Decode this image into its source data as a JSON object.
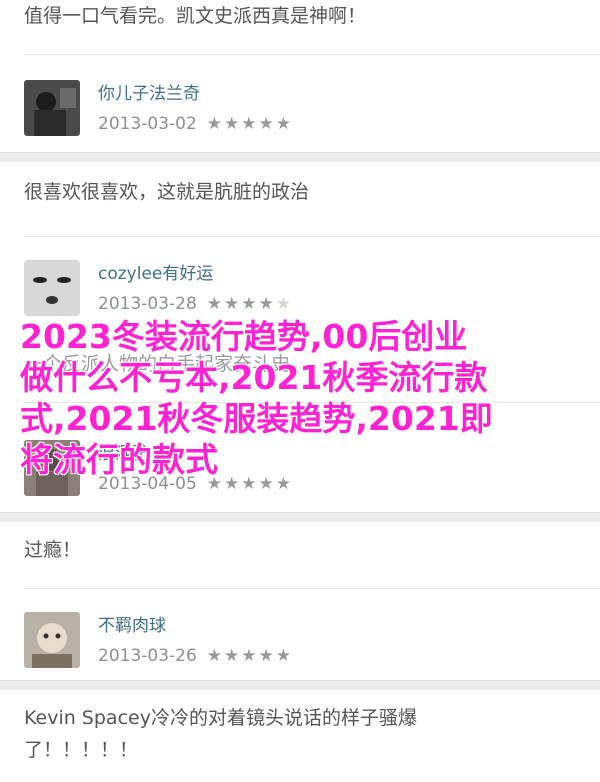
{
  "reviews": [
    {
      "comment": "值得一口气看完。凯文史派西真是神啊！"
    },
    {
      "username": "你儿子法兰奇",
      "date": "2013-03-02",
      "stars": 5,
      "comment": "很喜欢很喜欢，这就是肮脏的政治"
    },
    {
      "username": "cozylee有好运",
      "date": "2013-03-28",
      "stars": 4,
      "comment": "一个反派人物的白手起家奋斗史"
    },
    {
      "username": "混混驴",
      "date": "2013-04-05",
      "stars": 5,
      "comment": "过瘾！"
    },
    {
      "username": "不羁肉球",
      "date": "2013-03-26",
      "stars": 5,
      "comment": "Kevin Spacey冷冷的对着镜头说话的样子骚爆了！！！！！"
    }
  ],
  "overlay": {
    "text": "2023冬装流行趋势,00后创业做什么不亏本,2021秋季流行款式,2021秋冬服装趋势,2021即将流行的款式",
    "color": "#ff22d2"
  },
  "icons": {
    "star": "star-icon"
  }
}
